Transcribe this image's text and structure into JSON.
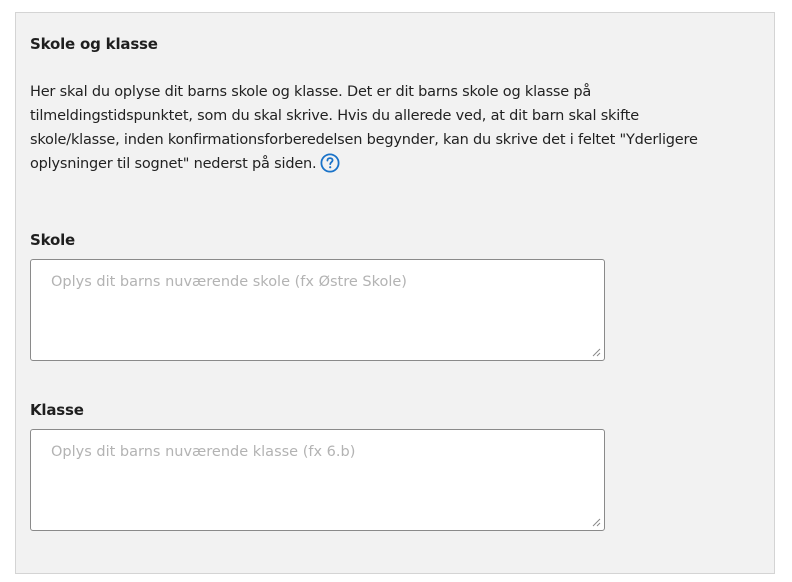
{
  "section": {
    "title": "Skole og klasse",
    "description": "Her skal du oplyse dit barns skole og klasse. Det er dit barns skole og klasse på tilmeldingstidspunktet, som du skal skrive. Hvis du allerede ved, at dit barn skal skifte skole/klasse, inden konfirmationsforberedelsen begynder, kan du skrive det i feltet \"Yderligere oplysninger til sognet\" nederst på siden.",
    "help_icon": "question-circle-icon"
  },
  "fields": {
    "skole": {
      "label": "Skole",
      "value": "",
      "placeholder": "Oplys dit barns nuværende skole (fx Østre Skole)"
    },
    "klasse": {
      "label": "Klasse",
      "value": "",
      "placeholder": "Oplys dit barns nuværende klasse (fx 6.b)"
    }
  },
  "colors": {
    "panel_background": "#f2f2f2",
    "panel_border": "#d4d4d4",
    "help_icon": "#1a73c9",
    "placeholder_text": "#b3b3b3"
  }
}
